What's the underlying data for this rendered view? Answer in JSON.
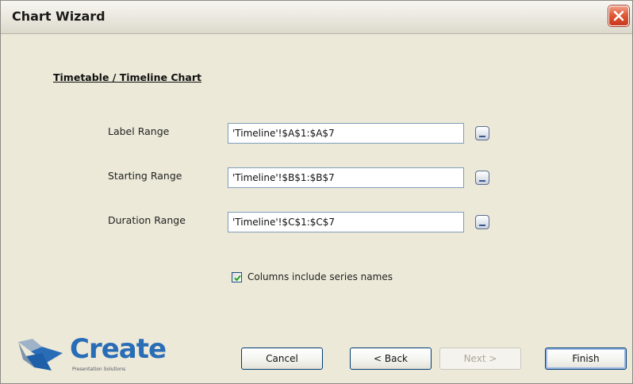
{
  "window": {
    "title": "Chart Wizard"
  },
  "section": {
    "heading": "Timetable / Timeline Chart"
  },
  "fields": [
    {
      "label": "Label Range",
      "value": "'Timeline'!$A$1:$A$7"
    },
    {
      "label": "Starting Range",
      "value": "'Timeline'!$B$1:$B$7"
    },
    {
      "label": "Duration Range",
      "value": "'Timeline'!$C$1:$C$7"
    }
  ],
  "options": {
    "series_names_label": "Columns include series names",
    "series_names_checked": true
  },
  "buttons": {
    "cancel": "Cancel",
    "back": "< Back",
    "next": "Next >",
    "finish": "Finish"
  },
  "logo": {
    "word": "Create",
    "tagline": "Presentation Solutions"
  },
  "colors": {
    "accent": "#2a6db7",
    "close": "#df5a36"
  },
  "icons": {
    "close": "close-icon",
    "checkmark": "checkmark-icon",
    "picker": "range-picker-icon"
  }
}
